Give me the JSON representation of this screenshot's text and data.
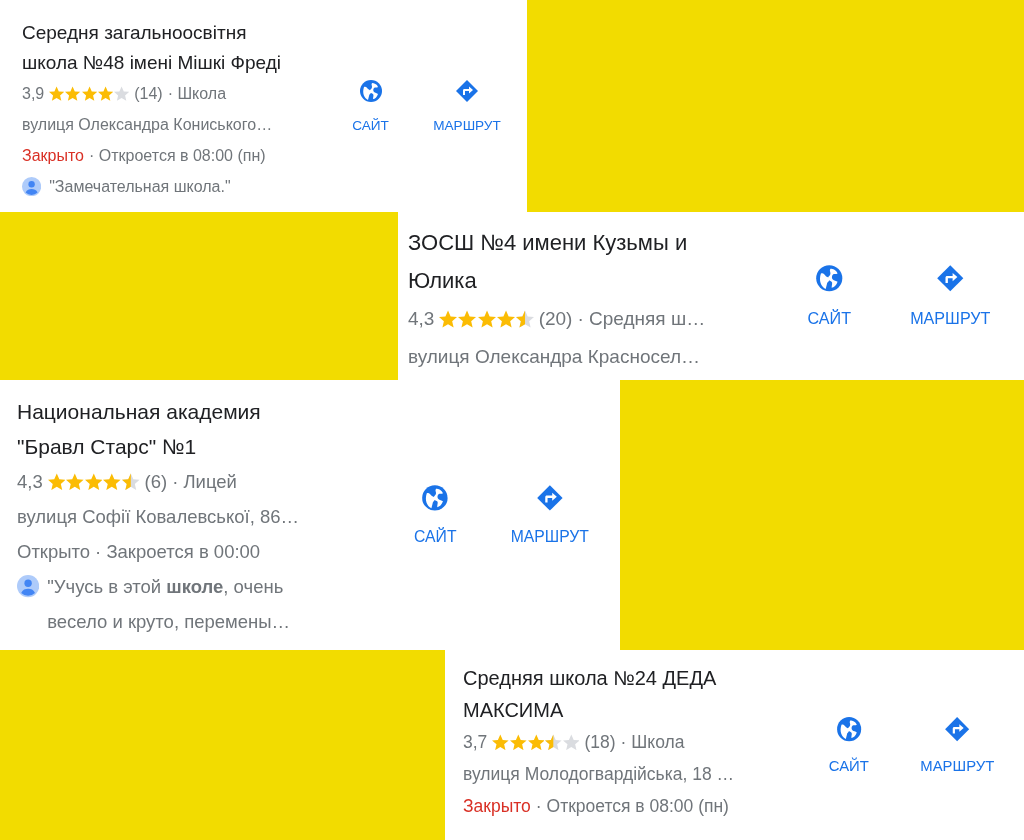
{
  "cards": [
    {
      "title": "Середня загальноосвітня школа №48 імені Мішкі Фреді",
      "rating": "3,9",
      "stars": 4,
      "reviews": "(14)",
      "category": "· Школа",
      "address": "вулиця Олександра Кониського…",
      "status": {
        "label": "Закрыто",
        "open": false,
        "detail": "· Откроется в 08:00 (пн)"
      },
      "review": "\"Замечательная школа.\"",
      "actions": [
        {
          "kind": "website",
          "label": "САЙТ"
        },
        {
          "kind": "directions",
          "label": "МАРШРУТ"
        }
      ]
    },
    {
      "title": "ЗОСШ №4 имени Кузьмы и Юлика",
      "rating": "4,3",
      "stars": 4.5,
      "reviews": "(20)",
      "category": "· Средняя ш…",
      "address": "вулиця Олександра Красносел…",
      "actions": [
        {
          "kind": "website",
          "label": "САЙТ"
        },
        {
          "kind": "directions",
          "label": "МАРШРУТ"
        }
      ]
    },
    {
      "title": "Национальная академия \"Бравл Старс\" №1",
      "rating": "4,3",
      "stars": 4.5,
      "reviews": "(6)",
      "category": "· Лицей",
      "address": "вулиця Софії Ковалевської, 86…",
      "status": {
        "label": "Открыто",
        "open": true,
        "detail": "· Закроется в 00:00"
      },
      "review": "\"Учусь в этой **школе**, очень весело и круто, перемены…",
      "actions": [
        {
          "kind": "website",
          "label": "САЙТ"
        },
        {
          "kind": "directions",
          "label": "МАРШРУТ"
        }
      ]
    },
    {
      "title": "Средняя школа №24 ДЕДА МАКСИМА",
      "rating": "3,7",
      "stars": 3.5,
      "reviews": "(18)",
      "category": "· Школа",
      "address": "вулиця Молодогвардійська, 18 …",
      "status": {
        "label": "Закрыто",
        "open": false,
        "detail": "· Откроется в 08:00 (пн)"
      },
      "actions": [
        {
          "kind": "website",
          "label": "САЙТ"
        },
        {
          "kind": "directions",
          "label": "МАРШРУТ"
        }
      ]
    }
  ]
}
